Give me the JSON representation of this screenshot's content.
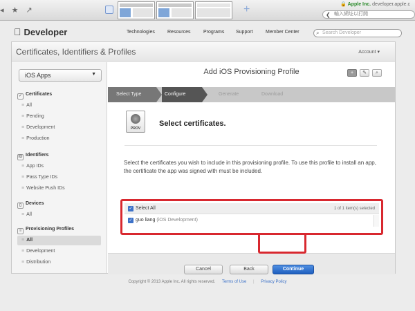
{
  "browser": {
    "site_name": "Apple Inc.",
    "domain": "developer.apple.c",
    "bookmark_text": "輸入網址以打開"
  },
  "dev_header": {
    "brand": "Developer",
    "nav": [
      "Technologies",
      "Resources",
      "Programs",
      "Support",
      "Member Center"
    ],
    "search_placeholder": "Search Developer"
  },
  "section": {
    "title": "Certificates, Identifiers & Profiles",
    "account": "Account ▾"
  },
  "sidebar": {
    "platform_select": "iOS Apps",
    "groups": [
      {
        "label": "Certificates",
        "items": [
          "All",
          "Pending",
          "Development",
          "Production"
        ]
      },
      {
        "label": "Identifiers",
        "items": [
          "App IDs",
          "Pass Type IDs",
          "Website Push IDs"
        ]
      },
      {
        "label": "Devices",
        "items": [
          "All"
        ]
      },
      {
        "label": "Provisioning Profiles",
        "items": [
          "All",
          "Development",
          "Distribution"
        ]
      }
    ],
    "active_item": "All"
  },
  "content": {
    "page_title": "Add iOS Provisioning Profile",
    "steps": [
      "Select Type",
      "Configure",
      "Generate",
      "Download"
    ],
    "current_step": "Configure",
    "cert_icon_label": "PROV",
    "heading": "Select certificates.",
    "description": "Select the certificates you wish to include in this provisioning profile. To use this profile to install an app, the certificate the app was signed with must be included.",
    "select_all_label": "Select All",
    "selected_count": "1 of 1 item(s) selected",
    "certificate_name": "guo liang",
    "certificate_type": "(iOS Development)",
    "buttons": {
      "cancel": "Cancel",
      "back": "Back",
      "continue": "Continue"
    }
  },
  "footer": {
    "copyright": "Copyright © 2013 Apple Inc. All rights reserved.",
    "terms": "Terms of Use",
    "privacy": "Privacy Policy"
  },
  "colors": {
    "highlight_red": "#d8282f",
    "primary_blue": "#2d6fd0"
  }
}
